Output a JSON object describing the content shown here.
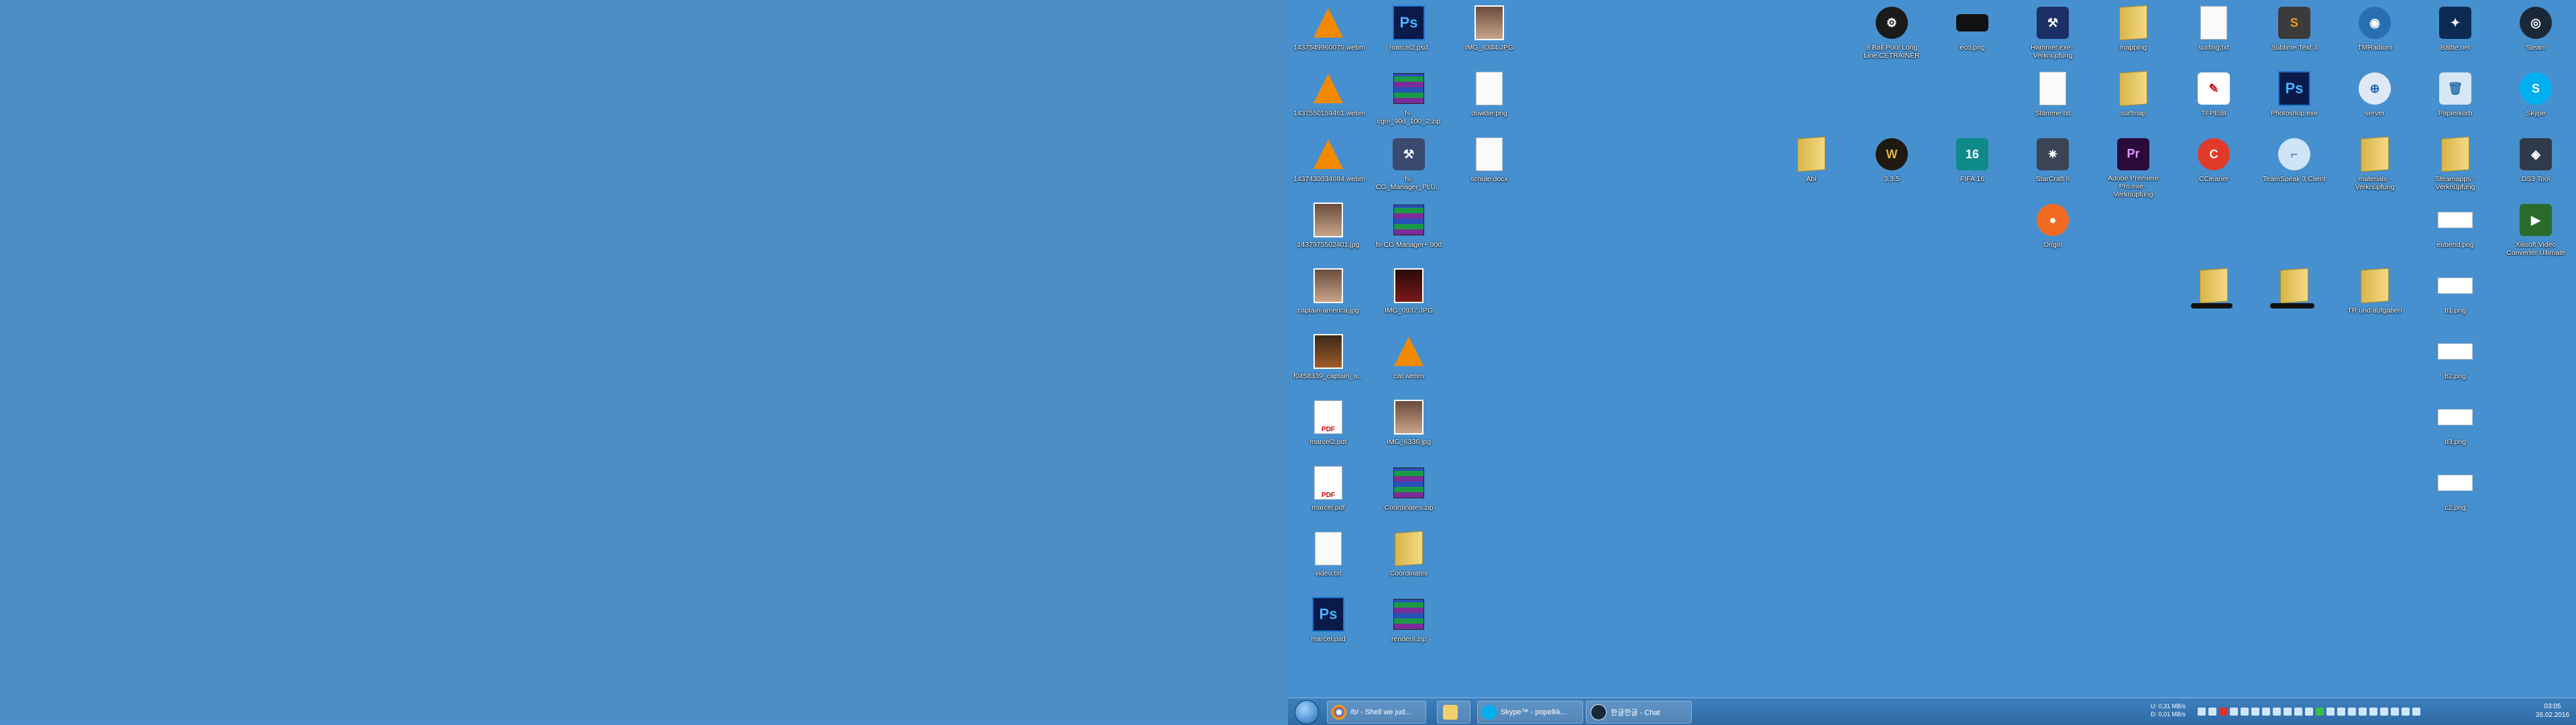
{
  "desktop": {
    "icons": [
      {
        "label": "1437549960075.webm",
        "type": "vlc"
      },
      {
        "label": "marcel2.psd",
        "type": "ps"
      },
      {
        "label": "IMG_6344.JPG",
        "type": "photo"
      },
      {
        "label": "1437550159461.webm",
        "type": "vlc"
      },
      {
        "label": "fs-cgm_90d_100_2.zip",
        "type": "zip"
      },
      {
        "label": "dowdie.png",
        "type": "doc"
      },
      {
        "label": "1437430034684.webm",
        "type": "vlc"
      },
      {
        "label": "fs-CG_Manager_PLU...",
        "type": "app"
      },
      {
        "label": "schule.docx",
        "type": "doc"
      },
      {
        "label": "1437975502401.jpg",
        "type": "photo"
      },
      {
        "label": "fs-CG Manager+ 90d",
        "type": "zip"
      },
      {
        "label": "captain-america.jpg",
        "type": "photo"
      },
      {
        "label": "IMG_0937.JPG",
        "type": "photo"
      },
      {
        "label": "f0458339_captain_a...",
        "type": "photo"
      },
      {
        "label": "cat.webm",
        "type": "vlc"
      },
      {
        "label": "marcel2.pdf",
        "type": "pdf"
      },
      {
        "label": "IMG_6336.jpg",
        "type": "photo"
      },
      {
        "label": "marcel.pdf",
        "type": "pdf"
      },
      {
        "label": "Coordinates.zip",
        "type": "zip"
      },
      {
        "label": "video.txt",
        "type": "doc"
      },
      {
        "label": "Coordinates",
        "type": "folder"
      },
      {
        "label": "marcel.psd",
        "type": "ps"
      },
      {
        "label": "renders.zip",
        "type": "zip"
      },
      {
        "label": "8 Ball Pool Long Line.CETRAINER",
        "type": "app"
      },
      {
        "label": "ecd.png",
        "type": "doc"
      },
      {
        "label": "Hammer.exe - Verknüpfung",
        "type": "app"
      },
      {
        "label": "mapping",
        "type": "folder"
      },
      {
        "label": "surfing.txt",
        "type": "doc"
      },
      {
        "label": "Sublime Text 3",
        "type": "app"
      },
      {
        "label": "TMRadium",
        "type": "app"
      },
      {
        "label": "Battle.net",
        "type": "app"
      },
      {
        "label": "Steam",
        "type": "app"
      },
      {
        "label": "Stämme.txt",
        "type": "doc"
      },
      {
        "label": "surfmap",
        "type": "folder"
      },
      {
        "label": "TFPEdit",
        "type": "app"
      },
      {
        "label": "Photoshop.exe",
        "type": "ps"
      },
      {
        "label": "server",
        "type": "app"
      },
      {
        "label": "Papierkorb",
        "type": "app"
      },
      {
        "label": "Skype",
        "type": "app"
      },
      {
        "label": "Abi",
        "type": "folder"
      },
      {
        "label": "3.3.5",
        "type": "app"
      },
      {
        "label": "FIFA 16",
        "type": "app"
      },
      {
        "label": "StarCraft II",
        "type": "app"
      },
      {
        "label": "Adobe Premiere Pro.exe - Verknüpfung",
        "type": "app"
      },
      {
        "label": "CCleaner",
        "type": "app"
      },
      {
        "label": "TeamSpeak 3 Client",
        "type": "app"
      },
      {
        "label": "materials - Verknüpfung",
        "type": "folder"
      },
      {
        "label": "Steamapps - Verknüpfung",
        "type": "folder"
      },
      {
        "label": "DS3 Tool",
        "type": "app"
      },
      {
        "label": "Origin",
        "type": "app"
      },
      {
        "label": "eubend.png",
        "type": "doc"
      },
      {
        "label": "Xilisoft Video Converter Ultimate",
        "type": "app"
      },
      {
        "label": "TR und aufgaben",
        "type": "folder"
      },
      {
        "label": "b1.png",
        "type": "doc"
      },
      {
        "label": "b2.png",
        "type": "doc"
      },
      {
        "label": "b3.png",
        "type": "doc"
      },
      {
        "label": "c2.png",
        "type": "doc"
      }
    ]
  },
  "taskbar": {
    "chrome_label": "/b/ - Shell we jud...",
    "skype_label": "Skype™ - popelkk...",
    "steam_label": "한글한글 - Chat",
    "net_up": "U: 0,31 MB/s",
    "net_down": "D: 0,01 MB/s",
    "time": "03:05",
    "date": "26.02.2016"
  }
}
